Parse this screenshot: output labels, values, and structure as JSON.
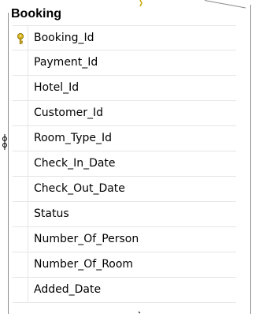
{
  "table": {
    "title": "Booking",
    "primary_key_icon": "key-icon",
    "columns": [
      "Booking_Id",
      "Payment_Id",
      "Hotel_Id",
      "Customer_Id",
      "Room_Type_Id",
      "Check_In_Date",
      "Check_Out_Date",
      "Status",
      "Number_Of_Person",
      "Number_Of_Room",
      "Added_Date"
    ]
  },
  "colors": {
    "border": "#8a8a8a",
    "gridline": "#e6e6e6",
    "key_icon": "#d4b21c"
  }
}
